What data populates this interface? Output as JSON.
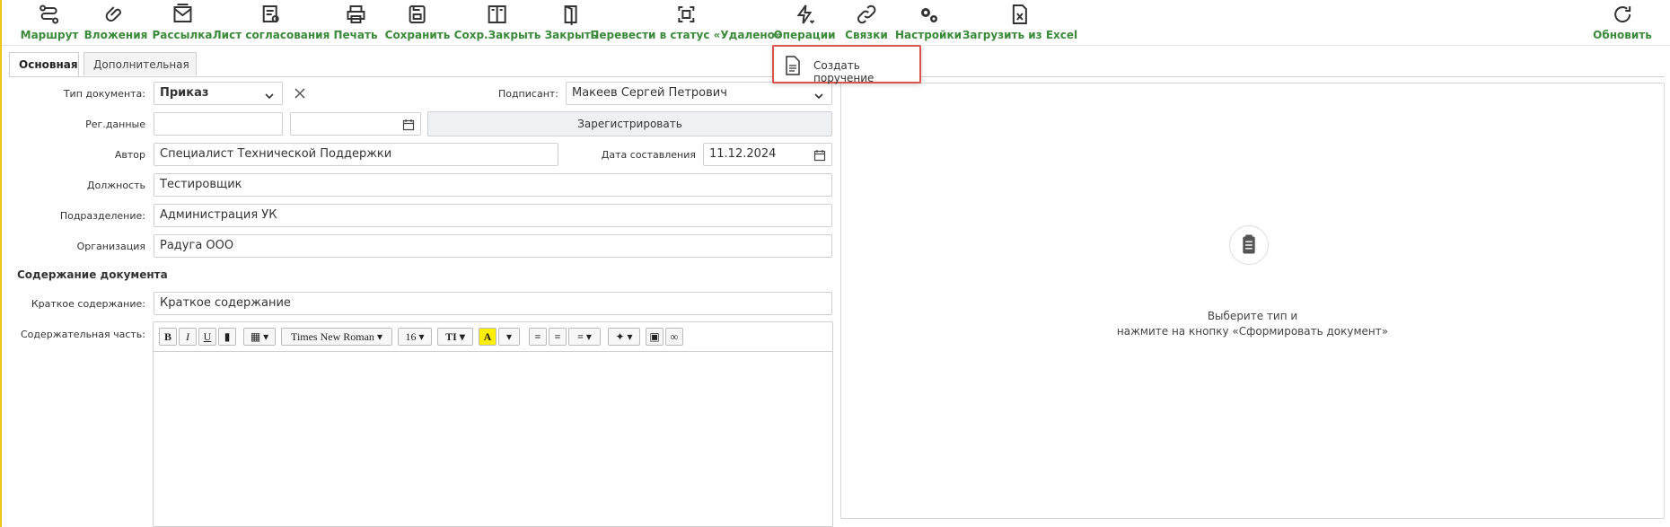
{
  "toolbar": {
    "items": [
      {
        "label": "Маршрут",
        "icon": "route-icon"
      },
      {
        "label": "Вложения",
        "icon": "paperclip-icon"
      },
      {
        "label": "Рассылка",
        "icon": "mail-icon"
      },
      {
        "label": "Лист согласования",
        "icon": "approval-sheet-icon"
      },
      {
        "label": "Печать",
        "icon": "printer-icon"
      },
      {
        "label": "Сохранить",
        "icon": "save-icon"
      },
      {
        "label": "Сохр.Закрыть",
        "icon": "save-close-icon"
      },
      {
        "label": "Закрыть",
        "icon": "door-icon"
      },
      {
        "label": "Перевести в статус «Удалено»",
        "icon": "status-delete-icon"
      },
      {
        "label": "Операции",
        "icon": "lightning-icon"
      },
      {
        "label": "Связки",
        "icon": "link-icon"
      },
      {
        "label": "Настройки",
        "icon": "gears-icon"
      },
      {
        "label": "Загрузить из Excel",
        "icon": "excel-icon"
      },
      {
        "label": "Обновить",
        "icon": "refresh-icon"
      }
    ],
    "accent_color": "#3a8a3a"
  },
  "operations_menu": {
    "item_label": "Создать поручение",
    "icon": "document-icon",
    "highlight_color": "#d9534f"
  },
  "tabs": [
    {
      "label": "Основная",
      "active": true
    },
    {
      "label": "Дополнительная",
      "active": false
    }
  ],
  "form": {
    "doc_type_label": "Тип документа:",
    "doc_type_value": "Приказ",
    "signer_label": "Подписант:",
    "signer_value": "Макеев Сергей Петрович",
    "reg_label": "Рег.данные",
    "reg_number_value": "",
    "reg_date_value": "",
    "register_button": "Зарегистрировать",
    "author_label": "Автор",
    "author_value": "Специалист Технической Поддержки",
    "created_date_label": "Дата составления",
    "created_date_value": "11.12.2024",
    "position_label": "Должность",
    "position_value": "Тестировщик",
    "department_label": "Подразделение:",
    "department_value": "Администрация УК",
    "organization_label": "Организация",
    "organization_value": "Радуга ООО",
    "content_section": "Содержание документа",
    "summary_label": "Краткое содержание:",
    "summary_value": "Краткое содержание",
    "body_label": "Содержательная часть:"
  },
  "editor": {
    "bold": "B",
    "italic": "I",
    "underline": "U",
    "font_family": "Times New Roman",
    "font_size": "16",
    "text_size_glyph": "TI",
    "font_color_glyph": "A"
  },
  "preview": {
    "line1": "Выберите тип и",
    "line2": "нажмите на кнопку «Сформировать документ»"
  }
}
